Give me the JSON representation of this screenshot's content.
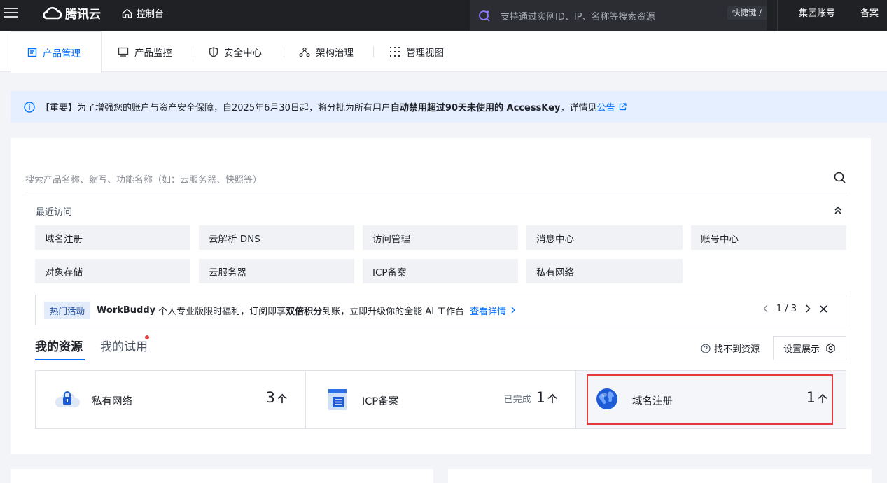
{
  "topbar": {
    "brand": "腾讯云",
    "console": "控制台",
    "search_placeholder": "支持通过实例ID、IP、名称等搜索资源",
    "shortcut": "快捷键 /",
    "group_account": "集团账号",
    "filing": "备案"
  },
  "tabs": [
    {
      "label": "产品管理",
      "icon": "document-icon",
      "active": true
    },
    {
      "label": "产品监控",
      "icon": "monitor-icon"
    },
    {
      "label": "安全中心",
      "icon": "shield-icon"
    },
    {
      "label": "架构治理",
      "icon": "architecture-icon"
    },
    {
      "label": "管理视图",
      "icon": "grid-dots-icon"
    }
  ],
  "notice": {
    "prefix": "【重要】",
    "text1": "为了增强您的账户与资产安全保障，自2025年6月30日起，将分批为所有用户",
    "bold": "自动禁用超过90天未使用的 AccessKey",
    "text2": "，详情见",
    "link": "公告"
  },
  "search": {
    "placeholder": "搜索产品名称、缩写、功能名称（如：云服务器、快照等）"
  },
  "recent": {
    "label": "最近访问",
    "items": [
      "域名注册",
      "云解析 DNS",
      "访问管理",
      "消息中心",
      "账号中心",
      "对象存储",
      "云服务器",
      "ICP备案",
      "私有网络"
    ]
  },
  "promo": {
    "badge": "热门活动",
    "brand": "WorkBuddy",
    "text1": " 个人专业版限时福利，订阅即享",
    "bold": "双倍积分",
    "text2": "到账，立即升级你的全能 AI 工作台",
    "more": "查看详情",
    "pager": "1 / 3"
  },
  "resources": {
    "tab_mine": "我的资源",
    "tab_trial": "我的试用",
    "not_found": "找不到资源",
    "settings": "设置展示",
    "cards": [
      {
        "name": "私有网络",
        "prefix": "",
        "count": "3",
        "unit": "个"
      },
      {
        "name": "ICP备案",
        "prefix": "已完成",
        "count": "1",
        "unit": "个"
      },
      {
        "name": "域名注册",
        "prefix": "",
        "count": "1",
        "unit": "个"
      }
    ]
  },
  "colors": {
    "accent": "#006eff",
    "highlight": "#e33b3b",
    "topbar": "#1f2125"
  }
}
